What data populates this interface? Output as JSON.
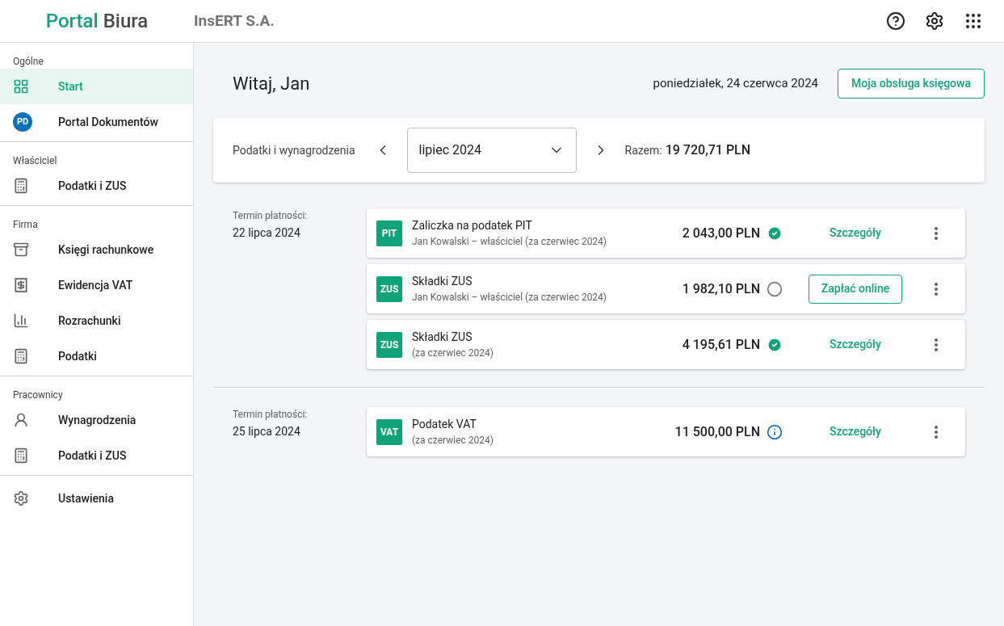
{
  "header": {
    "logo_primary": "Portal",
    "logo_secondary": "Biura",
    "company": "InsERT S.A."
  },
  "sidebar": {
    "sections": [
      {
        "title": "Ogólne",
        "items": [
          {
            "label": "Start",
            "selected": true
          },
          {
            "label": "Portal Dokumentów",
            "selected": false,
            "badge": "PD"
          }
        ]
      },
      {
        "title": "Właściciel",
        "items": [
          {
            "label": "Podatki i ZUS",
            "selected": false
          }
        ]
      },
      {
        "title": "Firma",
        "items": [
          {
            "label": "Księgi rachunkowe",
            "selected": false
          },
          {
            "label": "Ewidencja VAT",
            "selected": false
          },
          {
            "label": "Rozrachunki",
            "selected": false
          },
          {
            "label": "Podatki",
            "selected": false
          }
        ]
      },
      {
        "title": "Pracownicy",
        "items": [
          {
            "label": "Wynagrodzenia",
            "selected": false
          },
          {
            "label": "Podatki i ZUS",
            "selected": false
          }
        ]
      },
      {
        "items": [
          {
            "label": "Ustawienia",
            "selected": false
          }
        ]
      }
    ]
  },
  "greeting": "Witaj, Jan",
  "date": "poniedziałek, 24 czerwca 2024",
  "accountant_button": "Moja obsługa księgowa",
  "period_bar": {
    "label": "Podatki i wynagrodzenia",
    "month": "lipiec 2024",
    "total_label": "Razem:",
    "total": "19 720,71 PLN"
  },
  "groups": [
    {
      "due_label": "Termin płatności:",
      "due_date": "22 lipca 2024",
      "payments": [
        {
          "kind": "paid",
          "badge": "PIT",
          "title": "Zaliczka na podatek PIT",
          "subtitle": "Jan Kowalski – właściciel (za czerwiec 2024)",
          "amount": "2 043,00 PLN",
          "action": {
            "kind": "link",
            "label": "Szczegóły"
          }
        },
        {
          "kind": "unpaid",
          "badge": "ZUS",
          "title": "Składki ZUS",
          "subtitle": "Jan Kowalski – właściciel (za czerwiec 2024)",
          "amount": "1 982,10 PLN",
          "action": {
            "kind": "button",
            "label": "Zapłać online"
          }
        },
        {
          "kind": "paid",
          "badge": "ZUS",
          "title": "Składki ZUS",
          "subtitle": "(za czerwiec 2024)",
          "amount": "4 195,61 PLN",
          "action": {
            "kind": "link",
            "label": "Szczegóły"
          }
        }
      ]
    },
    {
      "due_label": "Termin płatności:",
      "due_date": "25 lipca 2024",
      "payments": [
        {
          "kind": "info",
          "badge": "VAT",
          "title": "Podatek VAT",
          "subtitle": "(za czerwiec 2024)",
          "amount": "11 500,00 PLN",
          "action": {
            "kind": "link",
            "label": "Szczegóły"
          }
        }
      ]
    }
  ]
}
